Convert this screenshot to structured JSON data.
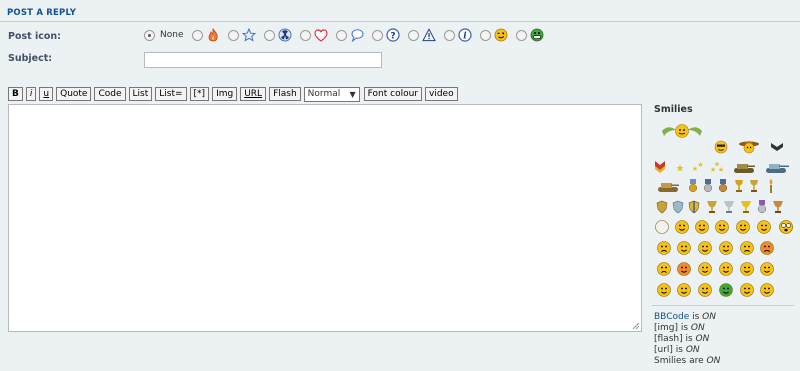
{
  "panel": {
    "title": "POST A REPLY"
  },
  "post_icon": {
    "label": "Post icon:",
    "none_label": "None",
    "icons": [
      "fire-icon",
      "star-icon",
      "radioactive-icon",
      "heart-icon",
      "speech-bubble-icon",
      "question-icon",
      "warning-icon",
      "info-icon",
      "winking-smiley-icon",
      "grinning-smiley-icon"
    ],
    "selected": "None"
  },
  "subject": {
    "label": "Subject:",
    "value": ""
  },
  "toolbar": {
    "buttons": [
      "B",
      "i",
      "u",
      "Quote",
      "Code",
      "List",
      "List=",
      "[*]",
      "Img",
      "URL",
      "Flash"
    ],
    "size_select": "Normal",
    "font_colour": "Font colour",
    "video": "video"
  },
  "message": {
    "value": ""
  },
  "smilies": {
    "title": "Smilies"
  },
  "status": {
    "bbcode_link": "BBCode",
    "bbcode_rest": " is ",
    "bbcode_state": "ON",
    "img": "[img] is ",
    "img_state": "ON",
    "flash": "[flash] is ",
    "flash_state": "ON",
    "url": "[url] is ",
    "url_state": "ON",
    "smilies": "Smilies are ",
    "smilies_state": "ON"
  }
}
